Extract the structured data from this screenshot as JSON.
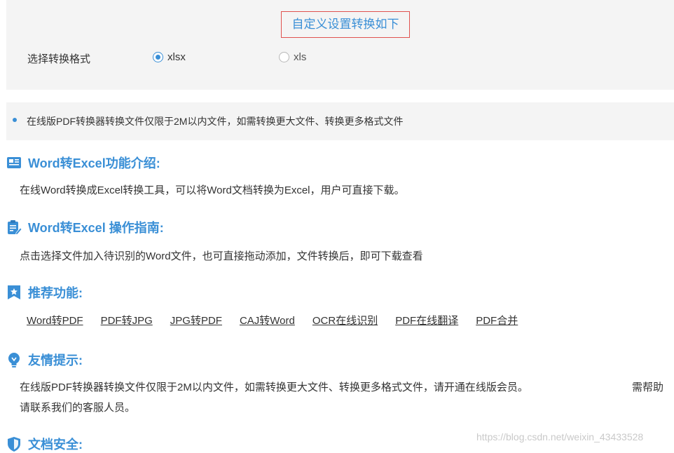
{
  "settings": {
    "title": "自定义设置转换如下",
    "format_label": "选择转换格式",
    "options": [
      {
        "label": "xlsx",
        "selected": true
      },
      {
        "label": "xls",
        "selected": false
      }
    ]
  },
  "notice": {
    "text": "在线版PDF转换器转换文件仅限于2M以内文件，如需转换更大文件、转换更多格式文件"
  },
  "sections": {
    "intro": {
      "title": "Word转Excel功能介绍:",
      "text": "在线Word转换成Excel转换工具，可以将Word文档转换为Excel，用户可直接下载。"
    },
    "guide": {
      "title": "Word转Excel 操作指南:",
      "text": "点击选择文件加入待识别的Word文件，也可直接拖动添加，文件转换后，即可下载查看"
    },
    "recommend": {
      "title": "推荐功能:",
      "links": [
        "Word转PDF",
        "PDF转JPG",
        "JPG转PDF",
        "CAJ转Word",
        "OCR在线识别",
        "PDF在线翻译",
        "PDF合并"
      ]
    },
    "tips": {
      "title": "友情提示:",
      "line1a": "在线版PDF转换器转换文件仅限于2M以内文件，如需转换更大文件、转换更多格式文件，请开通在线版会员。",
      "line1b": "需帮助",
      "line2": "请联系我们的客服人员。"
    },
    "security": {
      "title": "文档安全:"
    }
  },
  "watermark": "https://blog.csdn.net/weixin_43433528",
  "colors": {
    "accent": "#3a8fd6",
    "highlight_border": "#e0524f",
    "panel_bg": "#f4f4f4",
    "text": "#333333"
  }
}
